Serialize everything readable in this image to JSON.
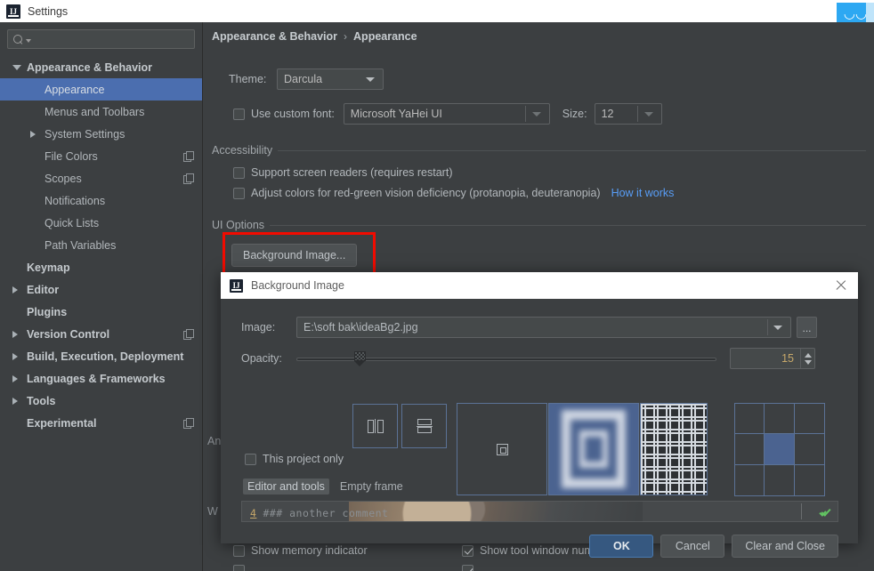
{
  "window": {
    "title": "Settings",
    "icon": "intellij-idea-icon",
    "tray_badge_icon": "cloud-sync-icon"
  },
  "sidebar": {
    "search": {
      "placeholder": "",
      "value": "",
      "icon": "search-icon",
      "dropdown_icon": "chevron-down-icon"
    },
    "items": [
      {
        "label": "Appearance & Behavior",
        "level": 0,
        "arrow": "open",
        "bold": true,
        "selected": false,
        "copy": false
      },
      {
        "label": "Appearance",
        "level": 1,
        "arrow": "none",
        "bold": false,
        "selected": true,
        "copy": false
      },
      {
        "label": "Menus and Toolbars",
        "level": 1,
        "arrow": "none",
        "bold": false,
        "selected": false,
        "copy": false
      },
      {
        "label": "System Settings",
        "level": 1,
        "arrow": "closed",
        "bold": false,
        "selected": false,
        "copy": false
      },
      {
        "label": "File Colors",
        "level": 1,
        "arrow": "none",
        "bold": false,
        "selected": false,
        "copy": true
      },
      {
        "label": "Scopes",
        "level": 1,
        "arrow": "none",
        "bold": false,
        "selected": false,
        "copy": true
      },
      {
        "label": "Notifications",
        "level": 1,
        "arrow": "none",
        "bold": false,
        "selected": false,
        "copy": false
      },
      {
        "label": "Quick Lists",
        "level": 1,
        "arrow": "none",
        "bold": false,
        "selected": false,
        "copy": false
      },
      {
        "label": "Path Variables",
        "level": 1,
        "arrow": "none",
        "bold": false,
        "selected": false,
        "copy": false
      },
      {
        "label": "Keymap",
        "level": 0,
        "arrow": "none",
        "bold": true,
        "selected": false,
        "copy": false
      },
      {
        "label": "Editor",
        "level": 0,
        "arrow": "closed",
        "bold": true,
        "selected": false,
        "copy": false
      },
      {
        "label": "Plugins",
        "level": 0,
        "arrow": "none",
        "bold": true,
        "selected": false,
        "copy": false
      },
      {
        "label": "Version Control",
        "level": 0,
        "arrow": "closed",
        "bold": true,
        "selected": false,
        "copy": true
      },
      {
        "label": "Build, Execution, Deployment",
        "level": 0,
        "arrow": "closed",
        "bold": true,
        "selected": false,
        "copy": false
      },
      {
        "label": "Languages & Frameworks",
        "level": 0,
        "arrow": "closed",
        "bold": true,
        "selected": false,
        "copy": false
      },
      {
        "label": "Tools",
        "level": 0,
        "arrow": "closed",
        "bold": true,
        "selected": false,
        "copy": false
      },
      {
        "label": "Experimental",
        "level": 0,
        "arrow": "none",
        "bold": true,
        "selected": false,
        "copy": true
      }
    ]
  },
  "main": {
    "breadcrumb": {
      "root": "Appearance & Behavior",
      "separator": "›",
      "leaf": "Appearance"
    },
    "theme": {
      "label": "Theme:",
      "value": "Darcula"
    },
    "custom_font": {
      "checkbox_label": "Use custom font:",
      "checked": false,
      "value": "Microsoft YaHei UI"
    },
    "size": {
      "label": "Size:",
      "value": "12"
    },
    "accessibility": {
      "section_title": "Accessibility",
      "screen_readers": {
        "label": "Support screen readers (requires restart)",
        "checked": false
      },
      "color_deficiency": {
        "label": "Adjust colors for red-green vision deficiency (protanopia, deuteranopia)",
        "checked": false
      },
      "how_it_works_link": "How it works"
    },
    "ui_options": {
      "section_title": "UI Options",
      "background_image_button": "Background Image...",
      "clipped_antialiasing_label": "An",
      "clipped_window_label": "W",
      "show_memory_indicator": {
        "label": "Show memory indicator",
        "checked": false
      },
      "show_tool_window_numbers": {
        "label": "Show tool window numbers",
        "checked": true
      }
    }
  },
  "dialog": {
    "title": "Background Image",
    "icon": "intellij-idea-icon",
    "close_icon": "close-icon",
    "image": {
      "label": "Image:",
      "value": "E:\\soft bak\\ideaBg2.jpg",
      "browse_button": "...",
      "dropdown_icon": "chevron-down-icon"
    },
    "opacity": {
      "label": "Opacity:",
      "value": "15",
      "min": 0,
      "max": 100
    },
    "mirror": [
      {
        "name": "mirror-horizontal",
        "selected": false
      },
      {
        "name": "mirror-vertical",
        "selected": false
      }
    ],
    "fill_modes": [
      {
        "name": "center",
        "selected": false
      },
      {
        "name": "scale",
        "selected": true
      },
      {
        "name": "tile",
        "selected": false
      }
    ],
    "anchor_grid": {
      "name": "anchor-position-grid",
      "cells": [
        false,
        false,
        false,
        false,
        true,
        false,
        false,
        false,
        false
      ]
    },
    "this_project_only": {
      "label": "This project only",
      "checked": false
    },
    "target_toggle": {
      "selected": "Editor and tools",
      "other": "Empty frame"
    },
    "preview": {
      "line_number": "4",
      "code": "### another comment",
      "status_icon": "check-ok-icon"
    },
    "buttons": {
      "ok": "OK",
      "cancel": "Cancel",
      "clear_and_close": "Clear and Close"
    }
  },
  "colors": {
    "panel_bg": "#3c3f41",
    "selection_blue": "#4b6eaf",
    "accent_blue": "#365880",
    "link_blue": "#589df6",
    "highlight_red": "#f20b00",
    "tray_blue": "#2da8f2"
  }
}
